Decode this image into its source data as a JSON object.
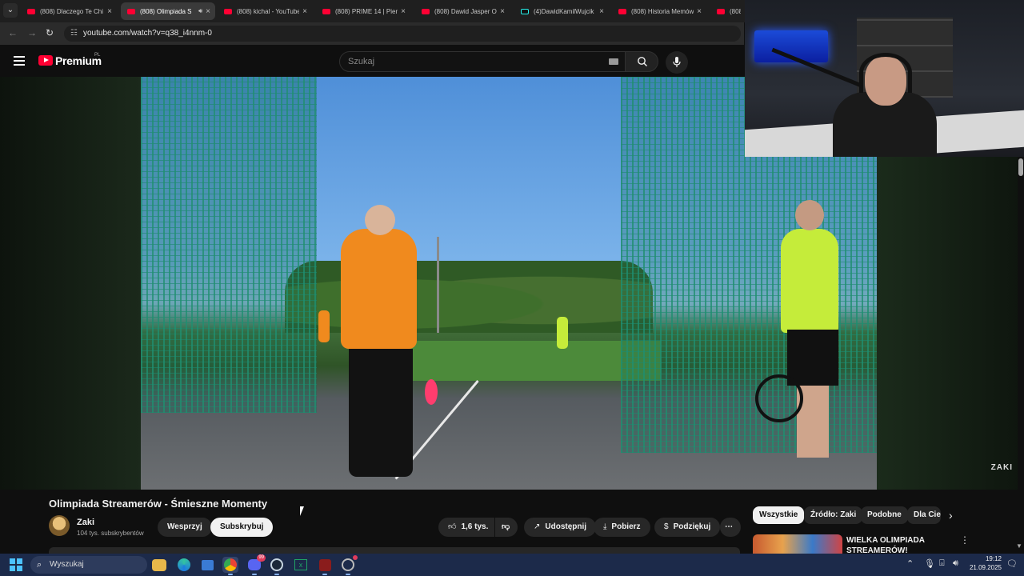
{
  "browser": {
    "tabs": [
      {
        "title": "(808) Dlaczego Te Chi",
        "active": false,
        "icon": "youtube-favicon"
      },
      {
        "title": "(808) Olimpiada S",
        "active": true,
        "audio": true,
        "icon": "youtube-favicon"
      },
      {
        "title": "(808) kichal - YouTube",
        "active": false,
        "icon": "youtube-favicon"
      },
      {
        "title": "(808) PRIME 14 | Pien",
        "active": false,
        "icon": "youtube-favicon"
      },
      {
        "title": "(808) Dawid Jasper O",
        "active": false,
        "icon": "youtube-favicon"
      },
      {
        "title": "(4)DawidKamilWujcik",
        "active": false,
        "icon": "tiktok-favicon"
      },
      {
        "title": "(808) Historia Memów",
        "active": false,
        "icon": "youtube-favicon"
      },
      {
        "title": "(808)",
        "active": false,
        "icon": "youtube-favicon"
      }
    ],
    "url": "youtube.com/watch?v=q38_i4nnm-0"
  },
  "masthead": {
    "logo_text": "Premium",
    "logo_region": "PL",
    "search_placeholder": "Szukaj"
  },
  "video": {
    "title": "Olimpiada Streamerów - Śmieszne Momenty",
    "watermark": "ZAKI"
  },
  "channel": {
    "name": "Zaki",
    "subscribers": "104 tys. subskrybentów",
    "support_label": "Wesprzyj",
    "subscribe_label": "Subskrybuj"
  },
  "actions": {
    "likes": "1,6 tys.",
    "share_label": "Udostępnij",
    "download_label": "Pobierz",
    "thanks_label": "Podziękuj"
  },
  "filter_chips": [
    "Wszystkie",
    "Źródło: Zaki",
    "Podobne",
    "Dla Cie"
  ],
  "recommendation": {
    "title": "WIELKA OLIMPIADA STREAMERÓW!"
  },
  "taskbar": {
    "search_placeholder": "Wyszukaj",
    "discord_badge": "99",
    "time": "19:12",
    "date": "21.09.2025"
  },
  "colors": {
    "youtube_red": "#ff0033",
    "page_bg": "#0f0f0f",
    "taskbar_bg": "#1c2a4a",
    "accent_blue": "#4cc2ff"
  }
}
